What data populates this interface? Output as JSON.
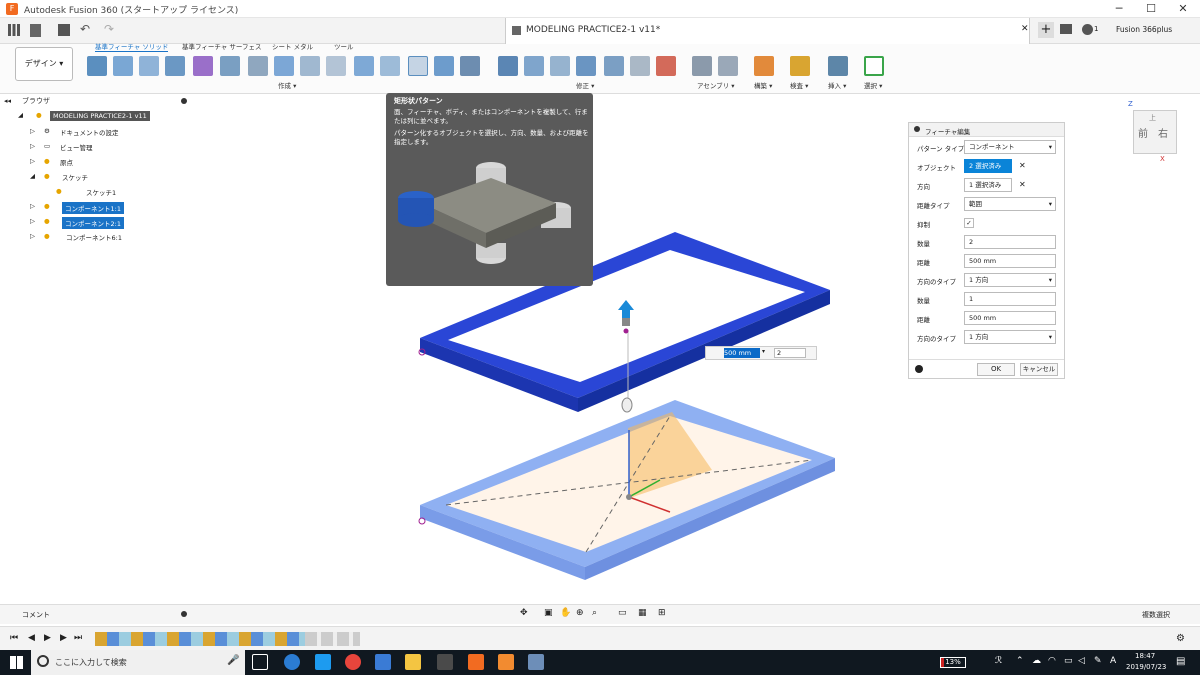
{
  "titlebar": {
    "title": "Autodesk Fusion 360 (スタートアップ ライセンス)",
    "min": "─",
    "max": "☐",
    "close": "✕"
  },
  "document": {
    "tab_title": "MODELING PRACTICE2-1 v11*",
    "tab_close": "✕",
    "new_tab": "+",
    "account_count": "1",
    "user": "Fusion 366plus"
  },
  "workspace": {
    "label": "デザイン ▾"
  },
  "ribbon": {
    "tabs": [
      "基準フィーチャ ソリッド",
      "基準フィーチャ サーフェス",
      "シート メタル",
      "ツール"
    ],
    "groups": [
      "作成 ▾",
      "修正 ▾",
      "アセンブリ ▾",
      "構築 ▾",
      "検査 ▾",
      "挿入 ▾",
      "選択 ▾"
    ]
  },
  "browser": {
    "title": "ブラウザ",
    "items": [
      {
        "label": "MODELING PRACTICE2-1 v11",
        "selected": true
      },
      {
        "label": "ドキュメントの設定"
      },
      {
        "label": "ビュー管理"
      },
      {
        "label": "原点"
      },
      {
        "label": "スケッチ"
      },
      {
        "label": "スケッチ1"
      },
      {
        "label": "コンポーネント1:1",
        "selected": true
      },
      {
        "label": "コンポーネント2:1",
        "selected": true
      },
      {
        "label": "コンポーネント6:1"
      }
    ]
  },
  "tooltip": {
    "title": "矩形状パターン",
    "line1": "面、フィーチャ、ボディ、またはコンポーネントを複製して、行または列に並べます。",
    "line2": "パターン化するオブジェクトを選択し、方向、数量、および距離を指定します。"
  },
  "canvas": {
    "distance_input": "500 mm",
    "count_input": "2"
  },
  "panel": {
    "title": "フィーチャ編集",
    "rows": [
      {
        "label": "パターン タイプ",
        "value": "コンポーネント"
      },
      {
        "label": "オブジェクト",
        "value": "2 選択済み"
      },
      {
        "label": "方向",
        "value": "1 選択済み"
      },
      {
        "label": "距離タイプ",
        "value": "範囲"
      },
      {
        "label": "抑制",
        "value": "✓"
      },
      {
        "label": "数量",
        "value": "2"
      },
      {
        "label": "距離",
        "value": "500 mm"
      },
      {
        "label": "方向のタイプ",
        "value": "1 方向"
      },
      {
        "label": "数量",
        "value": "1"
      },
      {
        "label": "距離",
        "value": "500 mm"
      },
      {
        "label": "方向のタイプ",
        "value": "1 方向"
      }
    ],
    "ok": "OK",
    "cancel": "キャンセル"
  },
  "viewcube": {
    "front": "前",
    "right": "右",
    "top": "上",
    "axis_z": "Z",
    "axis_x": "X"
  },
  "bottom": {
    "comment": "コメント",
    "multi_select": "複数選択"
  },
  "taskbar": {
    "search_placeholder": "ここに入力して検索",
    "battery": "13%",
    "time": "18:47",
    "date": "2019/07/23",
    "ime": "A"
  }
}
